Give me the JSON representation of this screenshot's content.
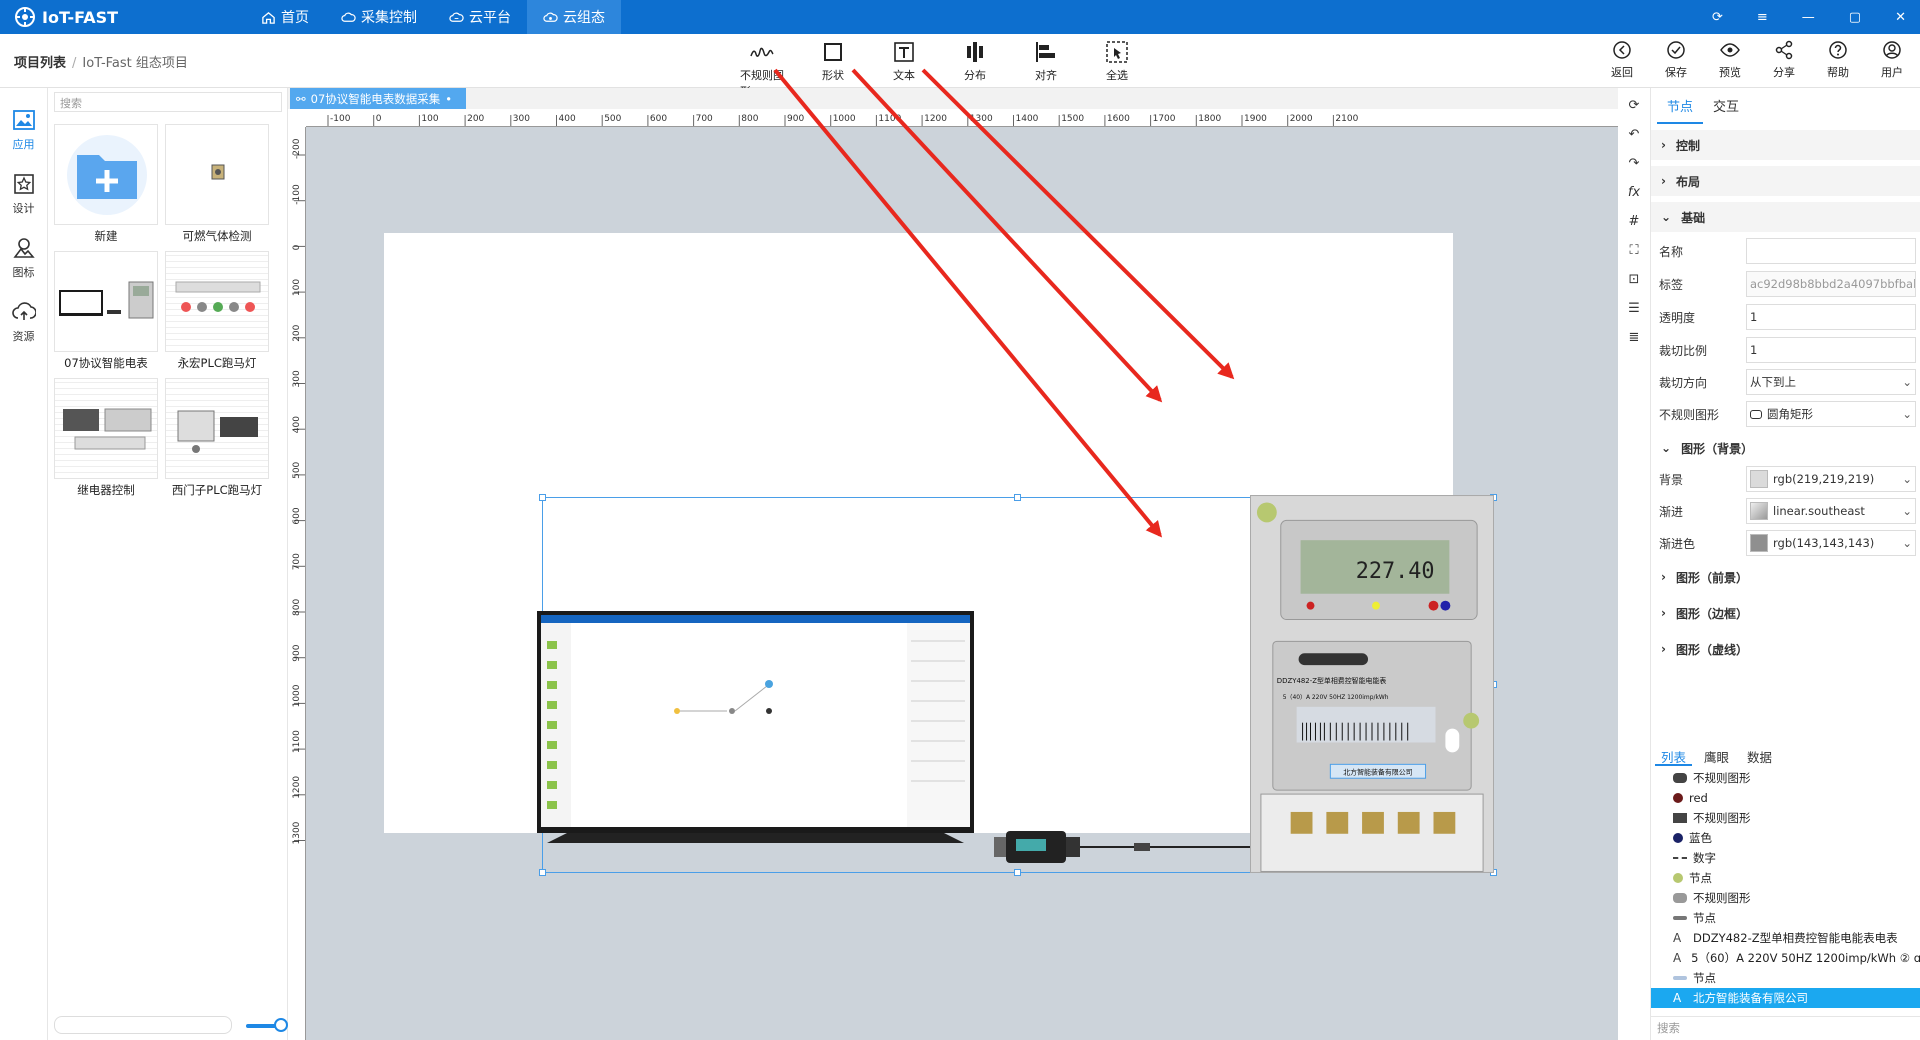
{
  "app": {
    "title": "IoT-FAST"
  },
  "nav": [
    {
      "label": "首页",
      "icon": "home-icon"
    },
    {
      "label": "采集控制",
      "icon": "cloud-gear-icon"
    },
    {
      "label": "云平台",
      "icon": "cloud-icon"
    },
    {
      "label": "云组态",
      "icon": "cloud-config-icon"
    }
  ],
  "breadcrumb": {
    "root": "项目列表",
    "sep": "/",
    "current": "IoT-Fast 组态项目"
  },
  "tools": [
    {
      "label": "不规则图形",
      "icon": "wave-icon"
    },
    {
      "label": "形状",
      "icon": "square-icon"
    },
    {
      "label": "文本",
      "icon": "text-icon"
    },
    {
      "label": "分布",
      "icon": "distribute-icon"
    },
    {
      "label": "对齐",
      "icon": "align-icon"
    },
    {
      "label": "全选",
      "icon": "select-all-icon"
    }
  ],
  "rtools": [
    {
      "label": "返回",
      "icon": "back-icon"
    },
    {
      "label": "保存",
      "icon": "save-icon"
    },
    {
      "label": "预览",
      "icon": "eye-icon"
    },
    {
      "label": "分享",
      "icon": "share-icon"
    },
    {
      "label": "帮助",
      "icon": "help-icon"
    },
    {
      "label": "用户",
      "icon": "user-icon"
    }
  ],
  "leftnav": [
    {
      "label": "应用",
      "icon": "image-icon",
      "active": true
    },
    {
      "label": "设计",
      "icon": "design-icon"
    },
    {
      "label": "图标",
      "icon": "shapes-icon"
    },
    {
      "label": "资源",
      "icon": "cloud-upload-icon"
    }
  ],
  "palette": {
    "search_placeholder": "搜索",
    "cards": [
      "新建",
      "可燃气体检测",
      "07协议智能电表",
      "永宏PLC跑马灯",
      "继电器控制",
      "西门子PLC跑马灯"
    ]
  },
  "canvas": {
    "tab_label": "07协议智能电表数据采集",
    "ruler_h": [
      "-100",
      "0",
      "100",
      "200",
      "300",
      "400",
      "500",
      "600",
      "700",
      "800",
      "900",
      "1000",
      "1100",
      "1200",
      "1300",
      "1400",
      "1500",
      "1600",
      "1700",
      "1800",
      "1900",
      "2000",
      "2100"
    ],
    "ruler_v": [
      "-200",
      "-100",
      "0",
      "100",
      "200",
      "300",
      "400",
      "500",
      "600",
      "700",
      "800",
      "900",
      "1000",
      "1100",
      "1200",
      "1300"
    ]
  },
  "meter": {
    "lcd": "227.40",
    "model": "DDZY482-Z型单相费控智能电能表",
    "spec": "5（40）A 220V 50HZ 1200imp/kWh",
    "maker": "北方智能装备有限公司"
  },
  "props": {
    "tabs": [
      "节点",
      "交互"
    ],
    "sections": {
      "control": "控制",
      "layout": "布局",
      "basic": "基础",
      "bg": "图形（背景）",
      "fg": "图形（前景）",
      "border": "图形（边框）",
      "dash": "图形（虚线）"
    },
    "fields": {
      "name": {
        "label": "名称",
        "value": ""
      },
      "tag": {
        "label": "标签",
        "value": "ac92d98b8bbd2a4097bbfbab"
      },
      "opacity": {
        "label": "透明度",
        "value": "1"
      },
      "clip_ratio": {
        "label": "裁切比例",
        "value": "1"
      },
      "clip_dir": {
        "label": "裁切方向",
        "value": "从下到上"
      },
      "irregular": {
        "label": "不规则图形",
        "value": "圆角矩形"
      },
      "bg": {
        "label": "背景",
        "value": "rgb(219,219,219)",
        "color": "#dbdbdb"
      },
      "gradient": {
        "label": "渐进",
        "value": "linear.southeast"
      },
      "gradient_color": {
        "label": "渐进色",
        "value": "rgb(143,143,143)",
        "color": "#8f8f8f"
      }
    },
    "list_tabs": [
      "列表",
      "鹰眼",
      "数据"
    ],
    "layers": [
      {
        "label": "不规则图形",
        "icon": "rounded-rect",
        "color": "#444444"
      },
      {
        "label": "red",
        "icon": "dot",
        "color": "#6b1a1a"
      },
      {
        "label": "不规则图形",
        "icon": "rect",
        "color": "#444444"
      },
      {
        "label": "蓝色",
        "icon": "dot",
        "color": "#1a2266"
      },
      {
        "label": "数字",
        "icon": "dash",
        "color": "#444444"
      },
      {
        "label": "节点",
        "icon": "dot",
        "color": "#b7c870"
      },
      {
        "label": "不规则图形",
        "icon": "rounded-rect",
        "color": "#999999"
      },
      {
        "label": "节点",
        "icon": "bar",
        "color": "#777777"
      },
      {
        "label": "DDZY482-Z型单相费控智能电能表电表",
        "icon": "text",
        "color": "#444444"
      },
      {
        "label": "5（60）A 220V 50HZ 1200imp/kWh ② ɑ",
        "icon": "text",
        "color": "#444444"
      },
      {
        "label": "节点",
        "icon": "bar",
        "color": "#b0c4de"
      },
      {
        "label": "北方智能装备有限公司",
        "icon": "text",
        "color": "#ffffff",
        "selected": true
      }
    ],
    "search_placeholder": "搜索"
  }
}
